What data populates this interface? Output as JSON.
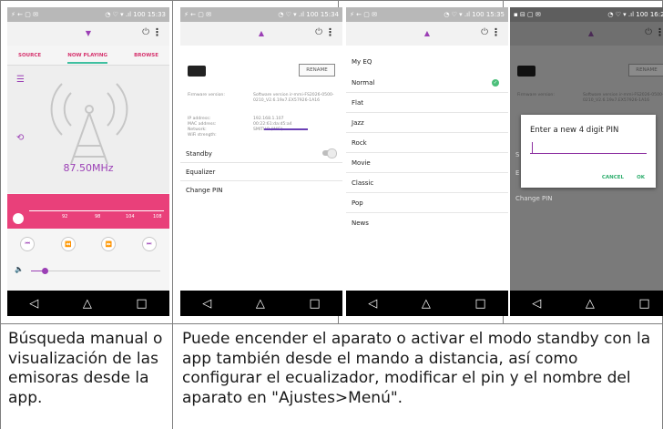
{
  "phones": [
    {
      "status": {
        "left": "⚡ ← ▢ ✉",
        "right": "◔ ♡ ▾ .ıl  100  15:33"
      },
      "tabs": [
        "SOURCE",
        "NOW PLAYING",
        "BROWSE"
      ],
      "frequency": "87.50MHz",
      "tuner_labels": [
        "92",
        "98",
        "104",
        "108"
      ],
      "volume_level": 0.12
    },
    {
      "status": {
        "left": "⚡ ← ▢ ✉",
        "right": "◔ ♡ ▾ .ıl  100  15:34"
      },
      "rename": "RENAME",
      "info": [
        {
          "k": "Firmware version:",
          "v": "Software version ir-mmi-FS2026-0500-0210_V2.6.19x7.EX57926-1A16"
        },
        {
          "k": "IP address:",
          "v": "192.168.1.107"
        },
        {
          "k": "MAC address:",
          "v": "00:22:61:da:d5:a4"
        },
        {
          "k": "Network:",
          "v": "SMITHO (WiFi)"
        },
        {
          "k": "WiFi strength:",
          "v": ""
        }
      ],
      "settings": [
        "Standby",
        "Equalizer",
        "Change PIN"
      ]
    },
    {
      "status": {
        "left": "⚡ ← ▢ ✉",
        "right": "◔ ♡ ▾ .ıl  100  15:35"
      },
      "header": "My EQ",
      "items": [
        "Normal",
        "Flat",
        "Jazz",
        "Rock",
        "Movie",
        "Classic",
        "Pop",
        "News"
      ]
    },
    {
      "status": {
        "left": "▪ ⊟ ▢ ✉",
        "right": "◔ ♡ ▾ .ıl  100  16:20"
      },
      "rename": "RENAME",
      "info_k": "Firmware version:",
      "info_v": "Software version ir-mmi-FS2026-0500-0210_V2.6.19x7.EX57926-1A16",
      "dialog": {
        "title": "Enter a new 4 digit PIN",
        "cancel": "CANCEL",
        "ok": "OK"
      },
      "partial_s": "S",
      "partial_e": "E",
      "change_pin": "Change PIN"
    }
  ],
  "nav": {
    "back": "◁",
    "home": "△",
    "recent": "□"
  },
  "captions": {
    "left": "Búsqueda manual o visualización de las emisoras desde la app.",
    "right": "Puede encender el aparato o activar el modo standby con la app también desde el mando a distancia, así como configurar el ecualizador, modificar el pin y el nombre del aparato en \"Ajustes>Menú\"."
  }
}
